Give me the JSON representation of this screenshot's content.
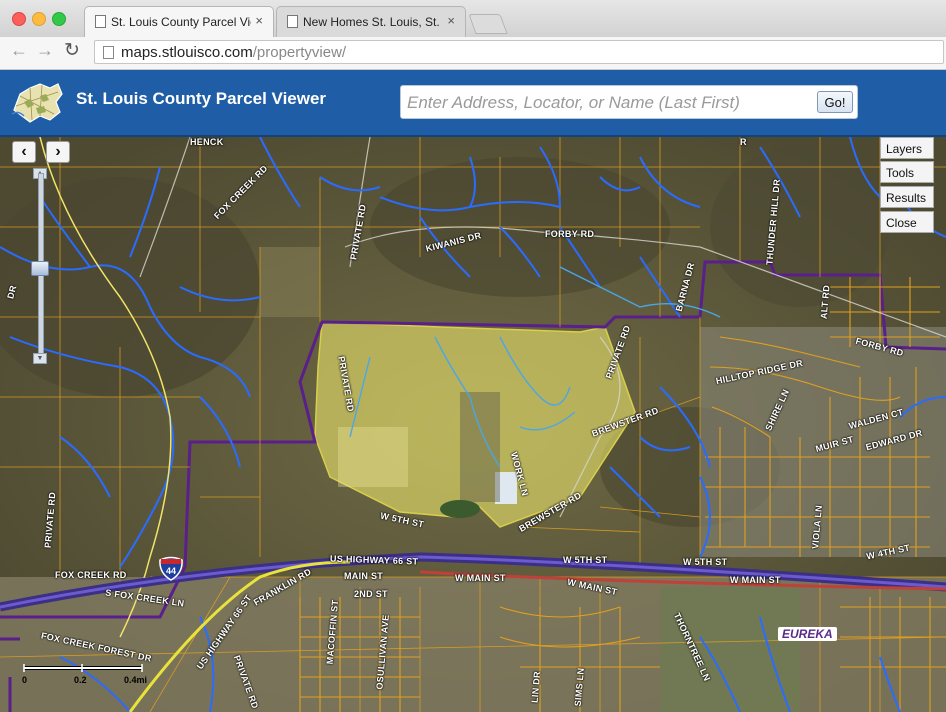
{
  "browser": {
    "tabs": [
      {
        "title": "St. Louis County Parcel Vie",
        "active": true
      },
      {
        "title": "New Homes St. Louis, St. C",
        "active": false
      }
    ],
    "close_glyph": "×",
    "url_host": "maps.stlouisco.com",
    "url_path": "/propertyview/"
  },
  "app": {
    "title": "St. Louis County Parcel Viewer",
    "search_placeholder": "Enter Address, Locator, or Name (Last First)",
    "go_label": "Go!",
    "brand_color": "#1f5da6"
  },
  "map": {
    "prev_extent": "‹",
    "next_extent": "›",
    "side_buttons": [
      "Layers",
      "Tools",
      "Results",
      "Close"
    ],
    "scale_labels": [
      "0",
      "0.2",
      "0.4mi"
    ],
    "city_label": "EUREKA",
    "interstate_shield": "44",
    "highlight_color": "#e6e06a",
    "parcel_line_color": "#e0a020",
    "stream_color": "#2a6cff",
    "boundary_color": "#5a1f8a",
    "streets": [
      "HENCK",
      "FOX CREEK RD",
      "PRIVATE RD",
      "KIWANIS DR",
      "FORBY RD",
      "BARNA DR",
      "THUNDER HILL DR",
      "ALT RD",
      "FORBY RD",
      "PRIVATE RD",
      "HILLTOP RIDGE DR",
      "SHIRE LN",
      "WALDEN CT",
      "MUIR ST",
      "EDWARD DR",
      "BREWSTER RD",
      "PRIVATE RD",
      "WORK LN",
      "BREWSTER RD",
      "W 5TH ST",
      "US HIGHWAY 66 ST",
      "W 5TH ST",
      "W 5TH ST",
      "W 4TH ST",
      "MAIN ST",
      "W MAIN ST",
      "W MAIN ST",
      "W MAIN ST",
      "FOX CREEK RD",
      "S FOX CREEK LN",
      "FRANKLIN RD",
      "2ND ST",
      "PRIVATE RD",
      "FOX CREEK FOREST DR",
      "US HIGHWAY 66 ST",
      "MACOFFIN ST",
      "OSULLIVAN AVE",
      "VIOLA LN",
      "THORNTREE LN",
      "LIN DR",
      "SIMS LN",
      "DR",
      "PRIVATE RD",
      "R"
    ]
  }
}
